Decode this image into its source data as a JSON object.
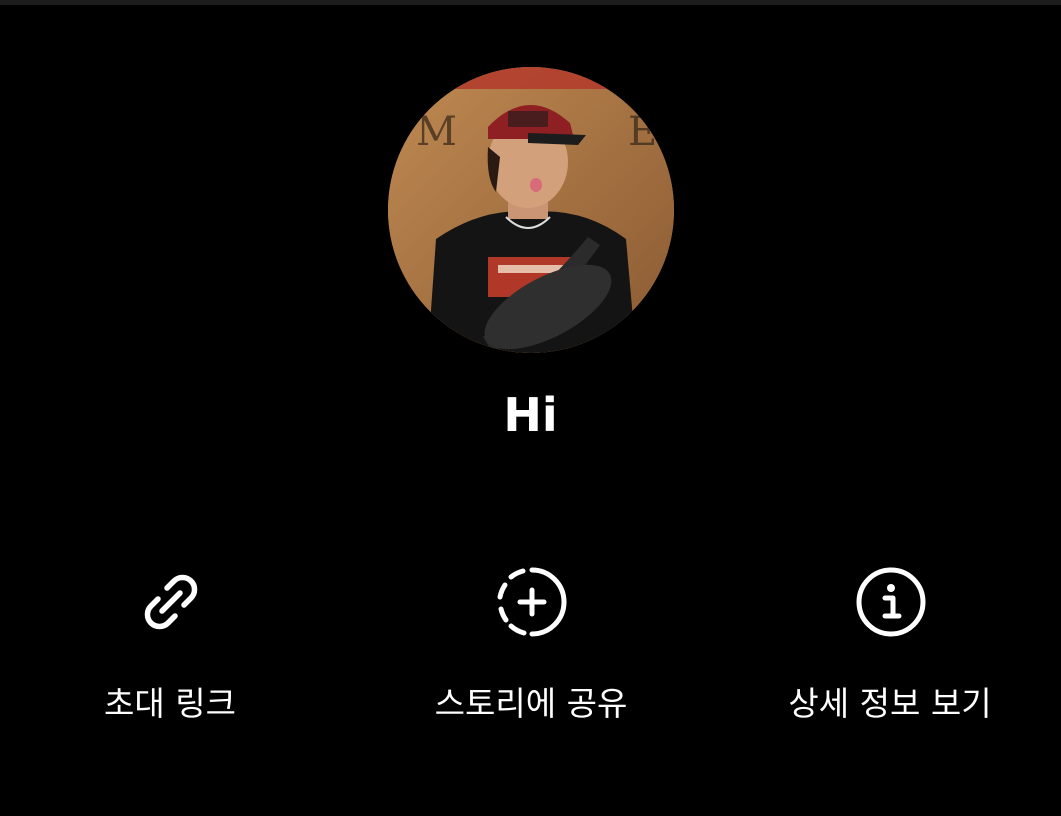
{
  "group": {
    "name": "Hi"
  },
  "actions": [
    {
      "label": "초대 링크",
      "icon": "link-icon"
    },
    {
      "label": "스토리에 공유",
      "icon": "add-story-icon"
    },
    {
      "label": "상세 정보 보기",
      "icon": "info-icon"
    }
  ],
  "colors": {
    "background": "#000000",
    "text": "#ffffff",
    "divider": "#1c1c1c"
  }
}
